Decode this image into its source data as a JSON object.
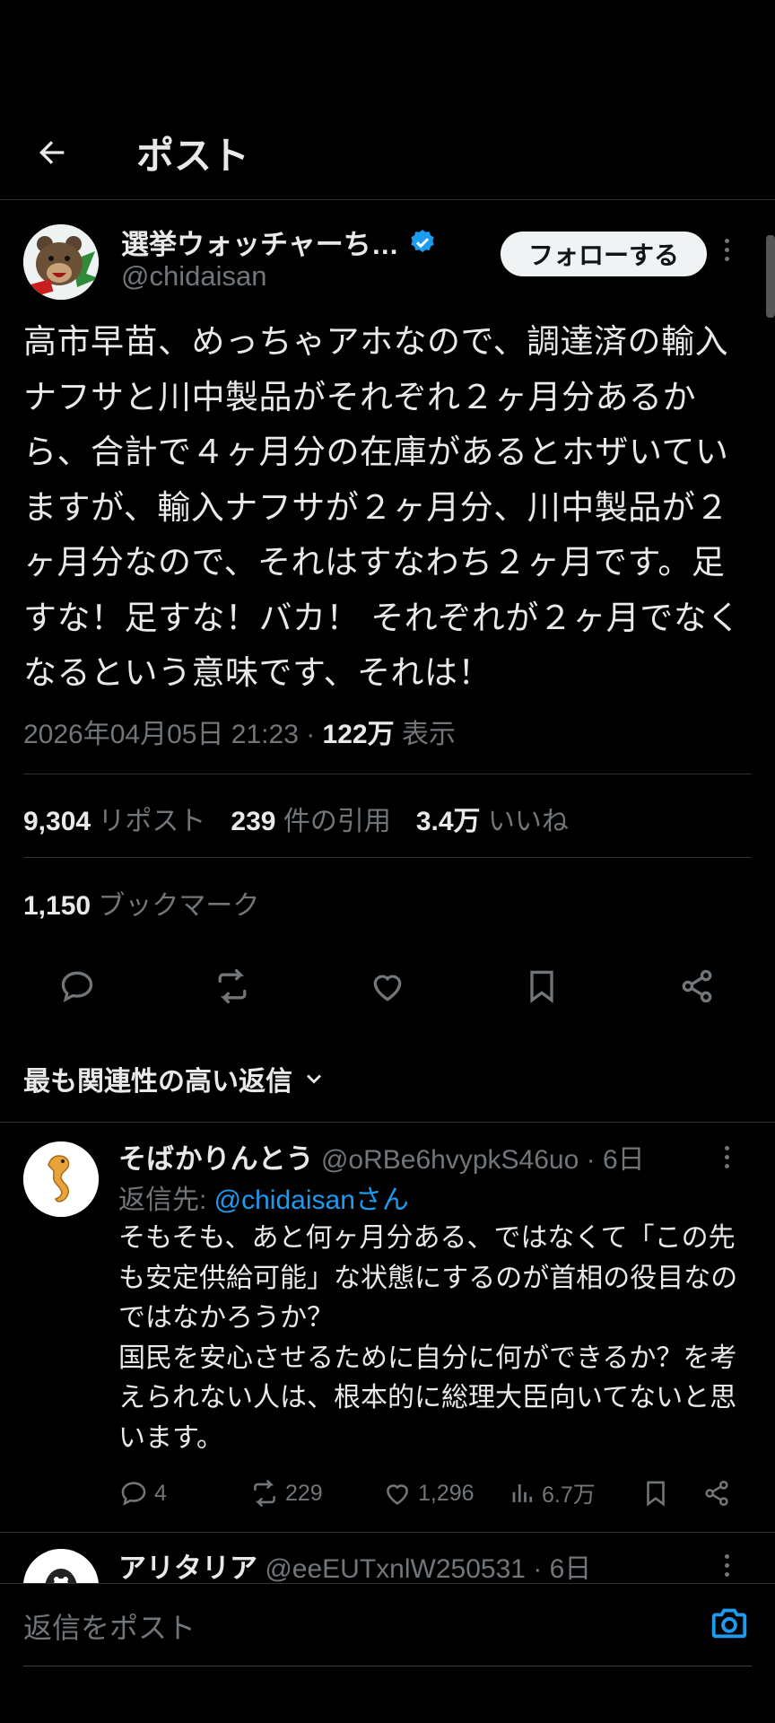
{
  "header": {
    "title": "ポスト"
  },
  "post": {
    "display_name": "選挙ウォッチャーち…",
    "handle": "@chidaisan",
    "follow_label": "フォローする",
    "text": "高市早苗、めっちゃアホなので、調達済の輸入ナフサと川中製品がそれぞれ２ヶ月分あるから、合計で４ヶ月分の在庫があるとホザいていますが、輸入ナフサが２ヶ月分、川中製品が２ヶ月分なので、それはすなわち２ヶ月です。足すな！足すな！バカ！ それぞれが２ヶ月でなくなるという意味です、それは！",
    "timestamp": "2026年04月05日 21:23 · ",
    "views_count": "122万",
    "views_label": " 表示"
  },
  "stats": {
    "reposts_count": "9,304",
    "reposts_label": "リポスト",
    "quotes_count": "239",
    "quotes_label": "件の引用",
    "likes_count": "3.4万",
    "likes_label": "いいね",
    "bookmarks_count": "1,150",
    "bookmarks_label": "ブックマーク"
  },
  "replies_sort": {
    "label": "最も関連性の高い返信"
  },
  "replies": [
    {
      "display_name": "そばかりんとう",
      "handle": "@oRBe6hvypkS46uo",
      "time": " · 6日",
      "reply_to_prefix": "返信先: ",
      "reply_to_handle": "@chidaisanさん",
      "text": "そもそも、あと何ヶ月分ある、ではなくて「この先も安定供給可能」な状態にするのが首相の役目なのではなかろうか？\n国民を安心させるために自分に何ができるか？を考えられない人は、根本的に総理大臣向いてないと思います。",
      "replies_count": "4",
      "reposts_count": "229",
      "likes_count": "1,296",
      "views_count": "6.7万"
    },
    {
      "display_name": "アリタリア",
      "handle": "@eeEUTxnlW250531",
      "time": " · 6日"
    }
  ],
  "composer": {
    "placeholder": "返信をポスト"
  },
  "colors": {
    "accent": "#1d9bf0",
    "background": "#000000",
    "muted": "#71767b",
    "divider": "#2f3336"
  },
  "icons": [
    "back-arrow-icon",
    "verified-badge-icon",
    "more-icon",
    "reply-icon",
    "repost-icon",
    "like-icon",
    "bookmark-icon",
    "share-icon",
    "chevron-down-icon",
    "views-icon",
    "camera-icon"
  ]
}
